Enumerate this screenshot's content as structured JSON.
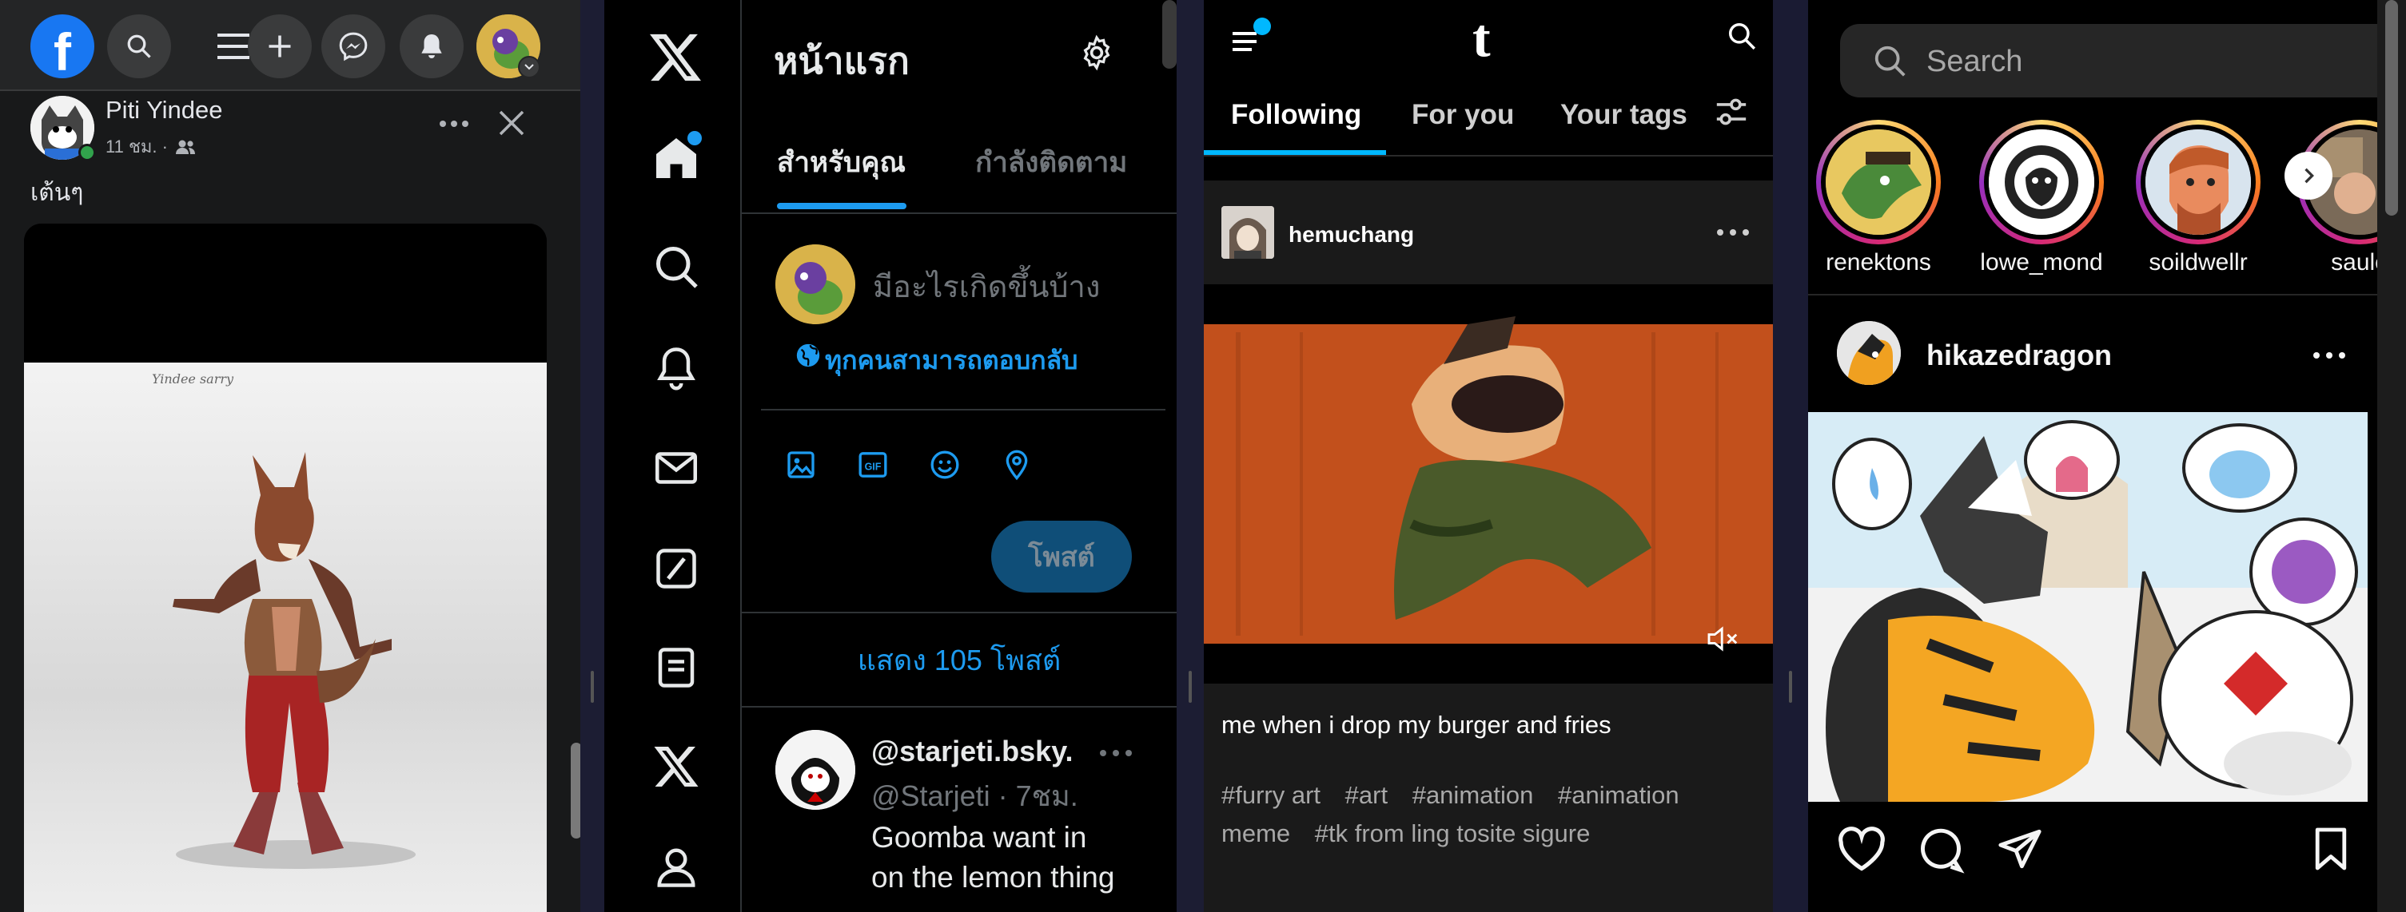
{
  "facebook": {
    "post": {
      "author": "Piti Yindee",
      "meta": "11 ชม. ·",
      "caption": "เต้นๆ",
      "image_signature": "Yindee sarry"
    }
  },
  "x": {
    "header": {
      "title": "หน้าแรก",
      "tab_for_you": "สำหรับคุณ",
      "tab_following": "กำลังติดตาม"
    },
    "composer": {
      "placeholder": "มีอะไรเกิดขึ้นบ้าง",
      "reply_setting": "ทุกคนสามารถตอบกลับ",
      "post_button": "โพสต์",
      "gif_label": "GIF"
    },
    "show_more": "แสดง 105 โพสต์",
    "tweet": {
      "display_name": "@starjeti.bsky.",
      "handle_time": "@Starjeti · 7ชม.",
      "text_line1": "Goomba want in",
      "text_line2": "on the lemon thing"
    },
    "colors": {
      "accent": "#1d9bf0",
      "background": "#000000"
    }
  },
  "tumblr": {
    "tabs": {
      "following": "Following",
      "for_you": "For you",
      "your_tags": "Your tags"
    },
    "logo": "t",
    "post": {
      "author": "hemuchang",
      "text": "me when i drop my burger and fries",
      "tags": [
        "#furry art",
        "#art",
        "#animation",
        "#animation meme",
        "#tk from ling tosite sigure"
      ]
    },
    "colors": {
      "accent": "#00b8ff"
    }
  },
  "instagram": {
    "search_placeholder": "Search",
    "stories": [
      {
        "name": "renektons",
        "ring": "gradient"
      },
      {
        "name": "lowe_mond",
        "ring": "gradient"
      },
      {
        "name": "soildwellr",
        "ring": "gradient"
      },
      {
        "name": "saulo",
        "ring": "gradient"
      }
    ],
    "post": {
      "author": "hikazedragon"
    }
  }
}
